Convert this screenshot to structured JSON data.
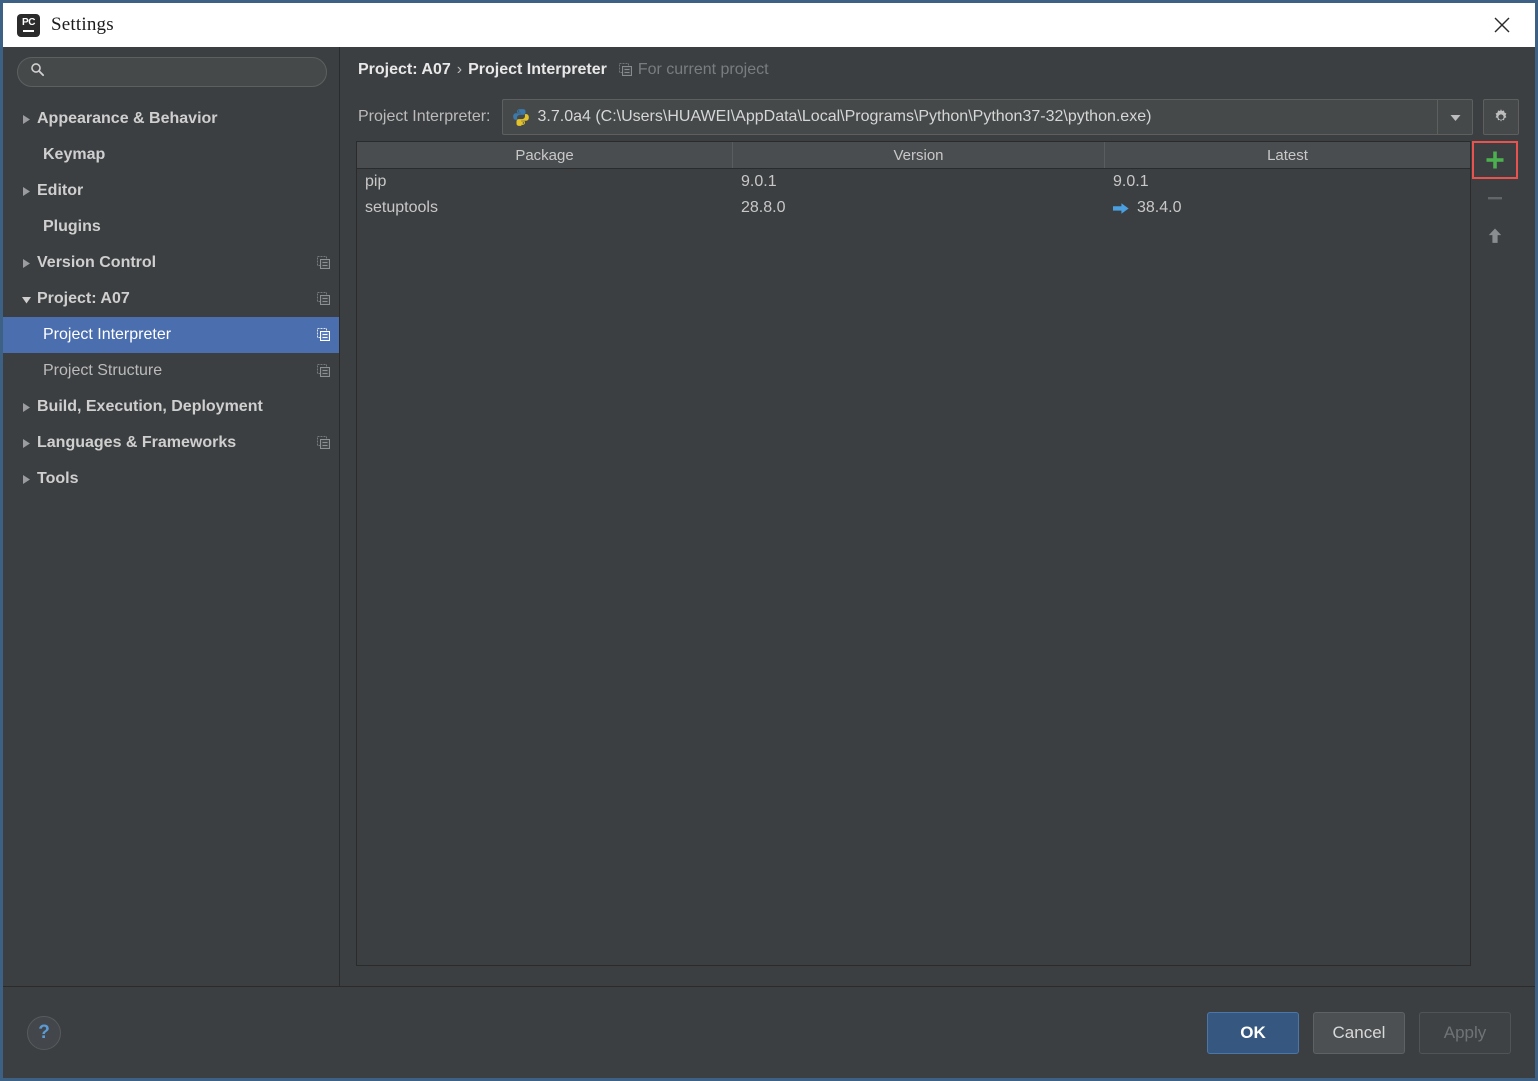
{
  "window": {
    "title": "Settings",
    "logo_icon": "pycharm-logo-icon",
    "close_icon": "close-icon",
    "accent_border": "#3d6185"
  },
  "sidebar": {
    "search": {
      "icon": "search-icon",
      "value": "",
      "placeholder": ""
    },
    "items": [
      {
        "label": "Appearance & Behavior",
        "level": "top",
        "arrow": "collapsed",
        "scope_icon": false,
        "selected": false
      },
      {
        "label": "Keymap",
        "level": "child",
        "arrow": "none",
        "scope_icon": false,
        "selected": false,
        "bold": true
      },
      {
        "label": "Editor",
        "level": "top",
        "arrow": "collapsed",
        "scope_icon": false,
        "selected": false
      },
      {
        "label": "Plugins",
        "level": "child",
        "arrow": "none",
        "scope_icon": false,
        "selected": false,
        "bold": true
      },
      {
        "label": "Version Control",
        "level": "top",
        "arrow": "collapsed",
        "scope_icon": true,
        "selected": false
      },
      {
        "label": "Project: A07",
        "level": "top",
        "arrow": "expanded",
        "scope_icon": true,
        "selected": false
      },
      {
        "label": "Project Interpreter",
        "level": "child",
        "arrow": "none",
        "scope_icon": true,
        "selected": true
      },
      {
        "label": "Project Structure",
        "level": "child",
        "arrow": "none",
        "scope_icon": true,
        "selected": false
      },
      {
        "label": "Build, Execution, Deployment",
        "level": "top",
        "arrow": "collapsed",
        "scope_icon": false,
        "selected": false
      },
      {
        "label": "Languages & Frameworks",
        "level": "top",
        "arrow": "collapsed",
        "scope_icon": true,
        "selected": false
      },
      {
        "label": "Tools",
        "level": "top",
        "arrow": "collapsed",
        "scope_icon": false,
        "selected": false
      }
    ],
    "selection_color": "#4b6eaf"
  },
  "breadcrumb": {
    "project": "Project: A07",
    "separator": "›",
    "page": "Project Interpreter",
    "scope_icon": "project-scope-icon",
    "note": "For current project"
  },
  "interpreter": {
    "label": "Project Interpreter:",
    "python_icon": "python-logo-icon",
    "value": "3.7.0a4 (C:\\Users\\HUAWEI\\AppData\\Local\\Programs\\Python\\Python37-32\\python.exe)",
    "dropdown_icon": "chevron-down-icon",
    "settings_icon": "gear-icon"
  },
  "packages": {
    "columns": [
      "Package",
      "Version",
      "Latest"
    ],
    "rows": [
      {
        "package": "pip",
        "version": "9.0.1",
        "latest": "9.0.1",
        "upgradable": false
      },
      {
        "package": "setuptools",
        "version": "28.8.0",
        "latest": "38.4.0",
        "upgradable": true
      }
    ],
    "upgrade_arrow_icon": "upgrade-arrow-icon",
    "upgrade_arrow_color": "#4a9fe0"
  },
  "table_tools": [
    {
      "name": "add-package-button",
      "icon": "plus-icon",
      "color": "#4caf50",
      "highlighted": true,
      "enabled": true
    },
    {
      "name": "remove-package-button",
      "icon": "minus-icon",
      "color": "#6b6e70",
      "highlighted": false,
      "enabled": false
    },
    {
      "name": "upgrade-package-button",
      "icon": "arrow-up-icon",
      "color": "#8a8d8f",
      "highlighted": false,
      "enabled": true
    }
  ],
  "highlight": {
    "color": "#e8534f"
  },
  "footer": {
    "help_label": "?",
    "ok_label": "OK",
    "cancel_label": "Cancel",
    "apply_label": "Apply"
  }
}
